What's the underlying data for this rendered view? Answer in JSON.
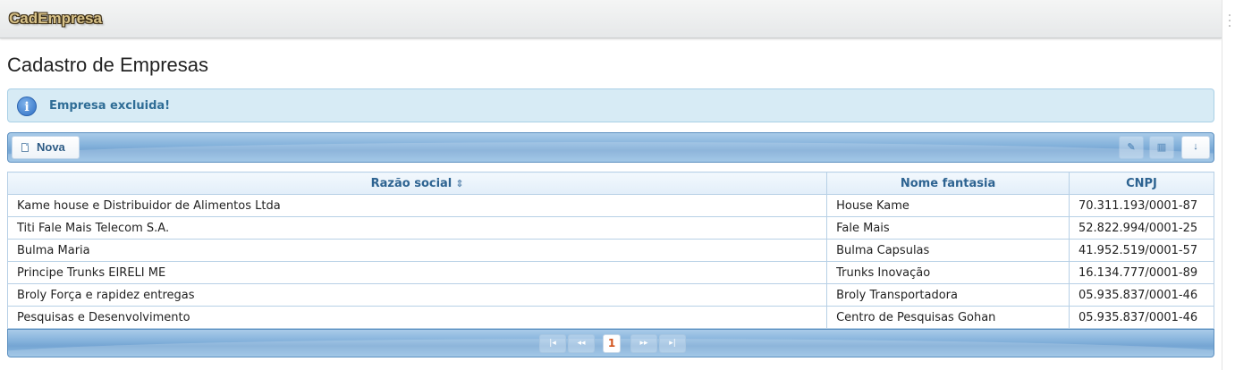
{
  "app": {
    "brand": "CadEmpresa"
  },
  "page": {
    "title": "Cadastro de Empresas"
  },
  "message": {
    "icon": "info-icon",
    "text": "Empresa excluida!"
  },
  "toolbar": {
    "new_label": "Nova",
    "edit_icon": "edit-icon",
    "delete_icon": "trash-icon",
    "download_icon": "download-icon"
  },
  "table": {
    "columns": [
      "Razão social",
      "Nome fantasia",
      "CNPJ"
    ],
    "rows": [
      [
        "Kame house e Distribuidor de Alimentos Ltda",
        "House Kame",
        "70.311.193/0001-87"
      ],
      [
        "Titi Fale Mais Telecom S.A.",
        "Fale Mais",
        "52.822.994/0001-25"
      ],
      [
        "Bulma Maria",
        "Bulma Capsulas",
        "41.952.519/0001-57"
      ],
      [
        "Principe Trunks EIRELI ME",
        "Trunks Inovação",
        "16.134.777/0001-89"
      ],
      [
        "Broly Força e rapidez entregas",
        "Broly Transportadora",
        "05.935.837/0001-46"
      ],
      [
        "Pesquisas e Desenvolvimento",
        "Centro de Pesquisas Gohan",
        "05.935.837/0001-46"
      ]
    ]
  },
  "paginator": {
    "current_page": "1"
  }
}
